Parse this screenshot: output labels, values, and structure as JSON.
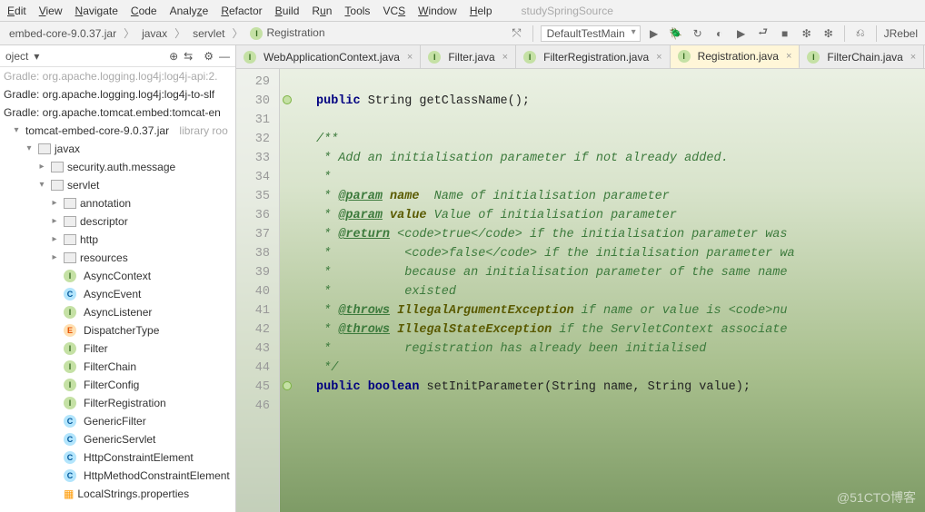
{
  "menu": [
    "Edit",
    "View",
    "Navigate",
    "Code",
    "Analyze",
    "Refactor",
    "Build",
    "Run",
    "Tools",
    "VCS",
    "Window",
    "Help"
  ],
  "projectName": "studySpringSource",
  "breadcrumbs": [
    "embed-core-9.0.37.jar",
    "javax",
    "servlet",
    "Registration"
  ],
  "runConfig": "DefaultTestMain",
  "jrebel": "JRebel",
  "sidebar": {
    "title": "oject",
    "truncated": [
      "Gradle: org.apache.logging.log4j:log4j-api:2.",
      "Gradle: org.apache.logging.log4j:log4j-to-slf",
      "Gradle: org.apache.tomcat.embed:tomcat-en"
    ],
    "jar": "tomcat-embed-core-9.0.37.jar",
    "jarHint": "library roo",
    "pkg_javax": "javax",
    "pkg_security": "security.auth.message",
    "pkg_servlet": "servlet",
    "subpkgs": [
      "annotation",
      "descriptor",
      "http",
      "resources"
    ],
    "classes": [
      {
        "b": "i",
        "n": "AsyncContext"
      },
      {
        "b": "c",
        "n": "AsyncEvent"
      },
      {
        "b": "i",
        "n": "AsyncListener"
      },
      {
        "b": "e",
        "n": "DispatcherType"
      },
      {
        "b": "i",
        "n": "Filter"
      },
      {
        "b": "i",
        "n": "FilterChain"
      },
      {
        "b": "i",
        "n": "FilterConfig"
      },
      {
        "b": "i",
        "n": "FilterRegistration"
      },
      {
        "b": "c",
        "n": "GenericFilter"
      },
      {
        "b": "c",
        "n": "GenericServlet"
      },
      {
        "b": "c",
        "n": "HttpConstraintElement"
      },
      {
        "b": "c",
        "n": "HttpMethodConstraintElement"
      }
    ],
    "props": "LocalStrings.properties"
  },
  "tabs": [
    {
      "label": "WebApplicationContext.java",
      "active": false
    },
    {
      "label": "Filter.java",
      "active": false
    },
    {
      "label": "FilterRegistration.java",
      "active": false
    },
    {
      "label": "Registration.java",
      "active": true
    },
    {
      "label": "FilterChain.java",
      "active": false
    }
  ],
  "gutterStart": 29,
  "gutterEnd": 46,
  "gutterMarks": [
    30,
    45
  ],
  "code": {
    "l30": {
      "pre": "public ",
      "t2": "String getClassName();"
    },
    "l32": "/**",
    "l33": " * Add an initialisation parameter if not already added.",
    "l34": " *",
    "l35": {
      "pre": " * ",
      "tag": "@param",
      "pn": " name",
      "rest": "  Name of initialisation parameter"
    },
    "l36": {
      "pre": " * ",
      "tag": "@param",
      "pn": " value",
      "rest": " Value of initialisation parameter"
    },
    "l37": {
      "pre": " * ",
      "tag": "@return",
      "rest": " <code>true</code> if the initialisation parameter was"
    },
    "l38": " *          <code>false</code> if the initialisation parameter wa",
    "l39": " *          because an initialisation parameter of the same name ",
    "l40": " *          existed",
    "l41": {
      "pre": " * ",
      "tag": "@throws",
      "pn": " IllegalArgumentException",
      "rest": " if name or value is <code>nu"
    },
    "l42": {
      "pre": " * ",
      "tag": "@throws",
      "pn": " IllegalStateException",
      "rest": " if the ServletContext associate"
    },
    "l43": " *          registration has already been initialised",
    "l44": " */",
    "l45": {
      "pre": "public boolean ",
      "t2": "setInitParameter(String name, String value);"
    }
  },
  "watermark": "@51CTO博客"
}
